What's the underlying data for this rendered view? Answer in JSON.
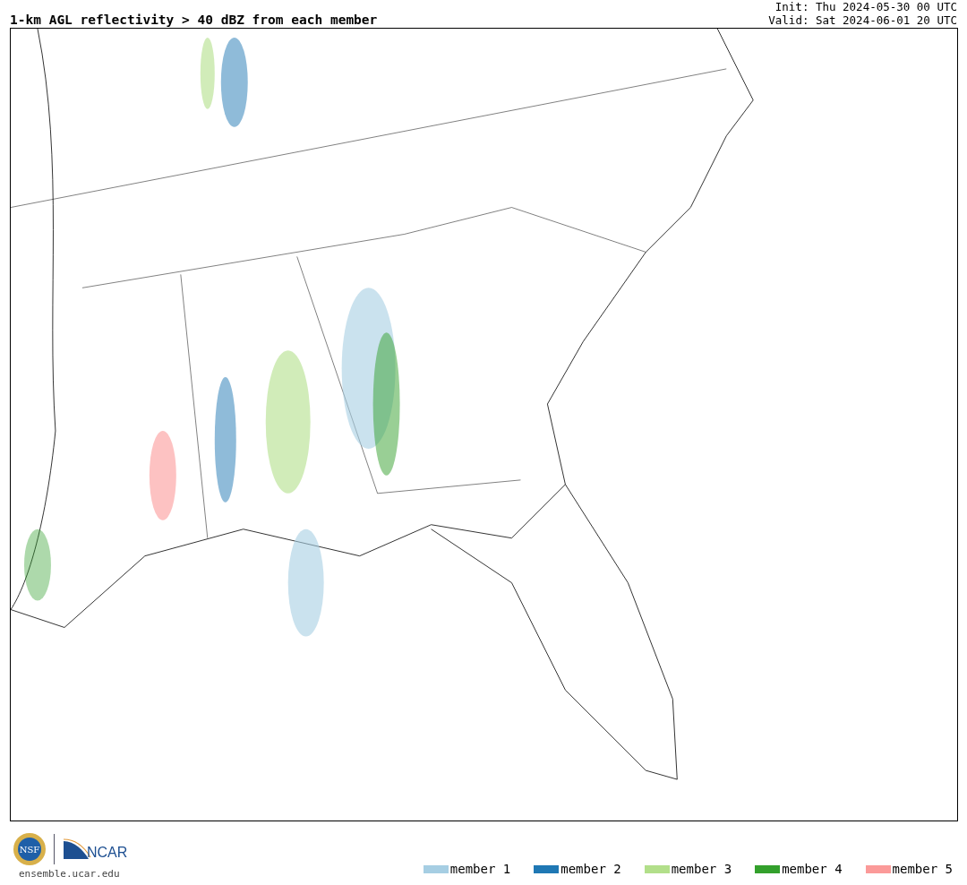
{
  "title": "1-km AGL reflectivity > 40 dBZ from each member",
  "init": "Init: Thu 2024-05-30 00 UTC",
  "valid": "Valid: Sat 2024-06-01 20 UTC",
  "logos": {
    "nsf": "NSF",
    "ncar": "NCAR"
  },
  "url": "ensemble.ucar.edu",
  "legend": [
    {
      "label": "member 1",
      "color": "#a6cee3"
    },
    {
      "label": "member 2",
      "color": "#1f78b4"
    },
    {
      "label": "member 3",
      "color": "#b2df8a"
    },
    {
      "label": "member 4",
      "color": "#33a02c"
    },
    {
      "label": "member 5",
      "color": "#fb9a99"
    }
  ]
}
